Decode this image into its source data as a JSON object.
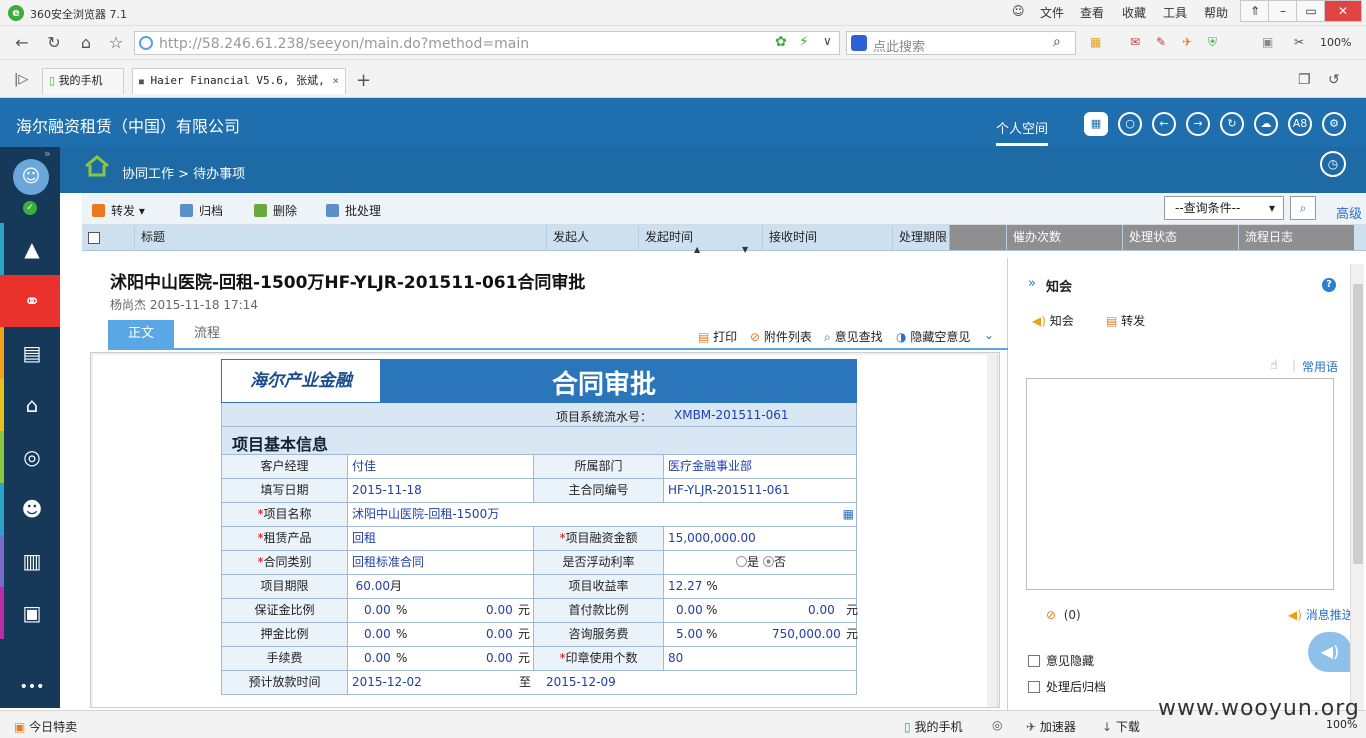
{
  "browser": {
    "title": "360安全浏览器 7.1",
    "menu": [
      "文件",
      "查看",
      "收藏",
      "工具",
      "帮助"
    ],
    "url_host": "http://58.246.61.238",
    "url_path": "/seeyon/main.do?method=main",
    "search_placeholder": "点此搜索",
    "zoom": "100%",
    "tabs": [
      {
        "label": "我的手机"
      },
      {
        "label": "Haier Financial V5.6, 张斌,"
      }
    ]
  },
  "header": {
    "org_name": "海尔融资租赁（中国）有限公司",
    "space_label": "个人空间",
    "icons": [
      "grid-icon",
      "search-icon",
      "back-icon",
      "forward-icon",
      "refresh-icon",
      "cloud-icon",
      "a8-icon",
      "gear-icon"
    ],
    "a8_label": "A8"
  },
  "sidebar": {
    "items": [
      {
        "icon": "avatar-icon"
      },
      {
        "icon": "navigate-icon",
        "color": "#2aa4c9"
      },
      {
        "icon": "share-icon",
        "color": "#e8322b"
      },
      {
        "icon": "calendar-icon",
        "color": "#f0a21c"
      },
      {
        "icon": "chart-icon",
        "color": "#e8c21c"
      },
      {
        "icon": "target-icon",
        "color": "#8cc63e"
      },
      {
        "icon": "contacts-icon",
        "color": "#2aa4c9"
      },
      {
        "icon": "book-icon",
        "color": "#7b6bc9"
      },
      {
        "icon": "news-icon",
        "color": "#c02aa4"
      }
    ],
    "more_label": "•••"
  },
  "breadcrumb": {
    "text": "协同工作 > 待办事项"
  },
  "toolbar": {
    "forward": "转发",
    "archive": "归档",
    "delete": "删除",
    "batch": "批处理",
    "query_select": "--查询条件--",
    "advanced": "高级"
  },
  "columns": [
    "标题",
    "发起人",
    "发起时间",
    "接收时间",
    "处理期限",
    "催办次数",
    "处理状态",
    "流程日志"
  ],
  "doc": {
    "title": "沭阳中山医院-回租-1500万HF-YLJR-201511-061合同审批",
    "meta": "杨尚杰 2015-11-18 17:14",
    "tab_body": "正文",
    "tab_flow": "流程",
    "actions": {
      "print": "打印",
      "attachments": "附件列表",
      "find_opinion": "意见查找",
      "hide_empty": "隐藏空意见"
    }
  },
  "form": {
    "brand": "海尔产业金融",
    "title": "合同审批",
    "serial_label": "项目系统流水号：",
    "serial_value": "XMBM-201511-061",
    "section": "项目基本信息",
    "rows": {
      "manager_label": "客户经理",
      "manager": "付佳",
      "dept_label": "所属部门",
      "dept": "医疗金融事业部",
      "date_label": "填写日期",
      "date": "2015-11-18",
      "main_contract_label": "主合同编号",
      "main_contract": "HF-YLJR-201511-061",
      "project_name_label": "项目名称",
      "project_name": "沭阳中山医院-回租-1500万",
      "lease_product_label": "租赁产品",
      "lease_product": "回租",
      "financing_label": "项目融资金额",
      "financing": "15,000,000.00",
      "contract_type_label": "合同类别",
      "contract_type": "回租标准合同",
      "float_rate_label": "是否浮动利率",
      "float_yes": "是",
      "float_no": "否",
      "term_label": "项目期限",
      "term": "60.00",
      "term_unit": "月",
      "yield_label": "项目收益率",
      "yield": "12.27",
      "pct": "%",
      "deposit_ratio_label": "保证金比例",
      "deposit_ratio": "0.00",
      "deposit_amount": "0.00",
      "yuan": "元",
      "down_ratio_label": "首付款比例",
      "down_ratio": "0.00",
      "down_amount": "0.00",
      "pledge_ratio_label": "押金比例",
      "pledge_ratio": "0.00",
      "pledge_amount": "0.00",
      "consult_label": "咨询服务费",
      "consult_ratio": "5.00",
      "consult_amount": "750,000.00",
      "fee_label": "手续费",
      "fee_ratio": "0.00",
      "fee_amount": "0.00",
      "seal_label": "印章使用个数",
      "seal": "80",
      "loan_time_label": "预计放款时间",
      "loan_from": "2015-12-02",
      "to": "至",
      "loan_to": "2015-12-09"
    }
  },
  "right": {
    "title": "知会",
    "notify": "知会",
    "forward": "转发",
    "common_phrases": "常用语",
    "attach_count": "(0)",
    "push": "消息推送",
    "hide_opinion": "意见隐藏",
    "archive_after": "处理后归档"
  },
  "status": {
    "left": "今日特卖",
    "phone": "我的手机",
    "accelerator": "加速器",
    "download": "下载",
    "zoom": "100%",
    "watermark": "www.wooyun.org"
  }
}
